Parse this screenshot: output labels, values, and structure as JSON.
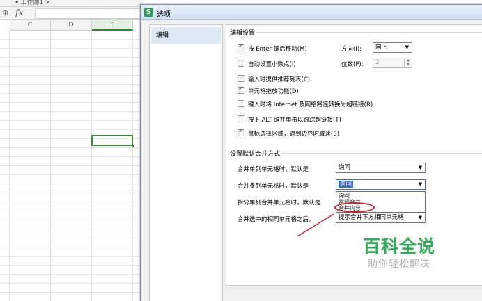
{
  "spreadsheet": {
    "tab_text": "▾ 工作簿1 ×",
    "zoom_icon": "magnifier-icon",
    "fx_label": "fx",
    "columns": [
      "C",
      "D",
      "E"
    ]
  },
  "dialog": {
    "title": "选项",
    "title_icon": "wps-s-icon",
    "title_icon_text": "S",
    "nav": {
      "items": [
        "编辑"
      ]
    },
    "edit_settings": {
      "group_title": "编辑设置",
      "options": [
        {
          "label": "按 Enter 键后移动(M)",
          "checked": true
        },
        {
          "label": "自动设置小数点(I)",
          "checked": false
        },
        {
          "label": "输入时提供推荐列表(C)",
          "checked": false
        },
        {
          "label": "单元格拖放功能(D)",
          "checked": true
        },
        {
          "label": "键入时将 Internet 及网络路径转换为超链接(R)",
          "checked": false
        },
        {
          "label": "按下 ALT 键并单击以跟踪超链接(T)",
          "checked": false
        },
        {
          "label": "鼠标选择区域，遇到边界时减速(S)",
          "checked": true
        }
      ],
      "direction_label": "方向(I):",
      "direction_value": "向下",
      "digits_label": "位数(P):",
      "digits_value": "2"
    },
    "merge_settings": {
      "group_title": "设置默认合并方式",
      "rows": [
        {
          "label": "合并单列单元格时，默认是",
          "value": "询问"
        },
        {
          "label": "合并多列单元格时，默认是",
          "value": "询问"
        },
        {
          "label": "拆分单列合并单元格时，默认是",
          "value": ""
        },
        {
          "label": "合并选中的相同单元格之后，",
          "value": "提示合并下方相同单元格"
        }
      ],
      "dropdown_options": [
        "询问",
        "常规合并",
        "合并内容"
      ]
    }
  },
  "watermark": {
    "title": "百科全说",
    "subtitle": "助你轻松解决"
  },
  "colors": {
    "accent_green": "#2fae56",
    "highlight_red": "#d9202a",
    "selection_blue": "#3a6ec7"
  }
}
